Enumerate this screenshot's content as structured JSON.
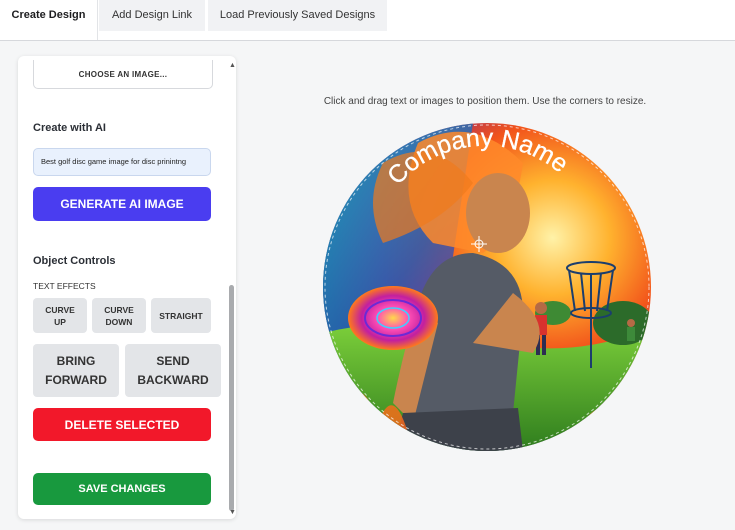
{
  "tabs": [
    {
      "label": "Create Design"
    },
    {
      "label": "Add Design Link"
    },
    {
      "label": "Load Previously Saved Designs"
    }
  ],
  "sidebar": {
    "choose_image_label": "CHOOSE AN IMAGE...",
    "create_ai_title": "Create with AI",
    "ai_prompt_value": "Best golf disc game image for disc prinintng",
    "generate_label": "GENERATE AI IMAGE",
    "object_controls_title": "Object Controls",
    "text_effects_label": "TEXT EFFECTS",
    "curve_up": "CURVE UP",
    "curve_down": "CURVE DOWN",
    "straight": "STRAIGHT",
    "bring_forward": "BRING FORWARD",
    "send_backward": "SEND BACKWARD",
    "delete_label": "DELETE SELECTED",
    "save_label": "SAVE CHANGES"
  },
  "canvas": {
    "instructions": "Click and drag text or images to position them. Use the corners to resize.",
    "curved_text": "Company Name"
  },
  "colors": {
    "generate": "#4a3df0",
    "delete": "#f2182a",
    "save": "#18993e"
  }
}
